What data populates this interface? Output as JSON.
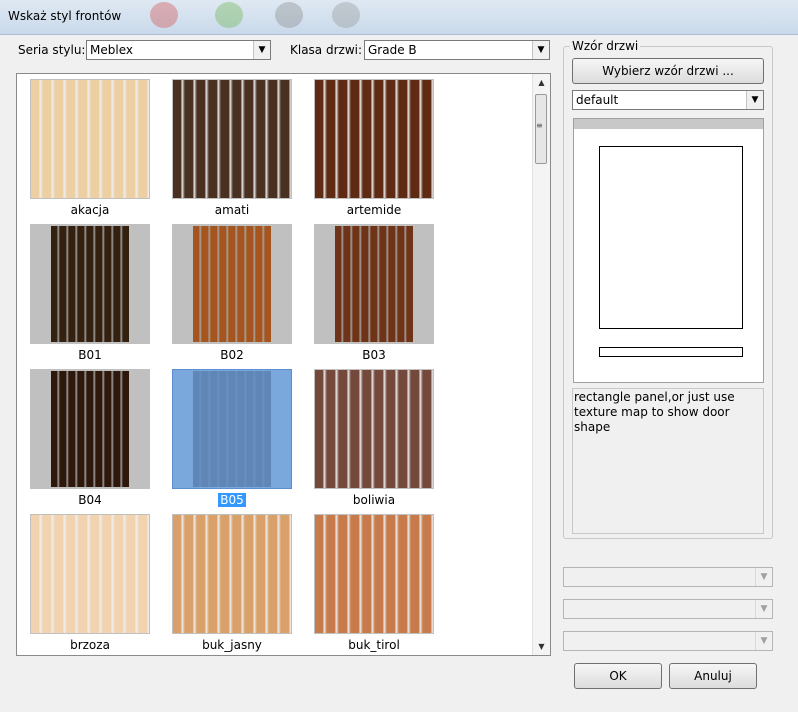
{
  "window": {
    "title": "Wskaż styl frontów"
  },
  "filters": {
    "series_label": "Seria stylu:",
    "series_value": "Meblex",
    "class_label": "Klasa drzwi:",
    "class_value": "Grade B"
  },
  "swatches": [
    {
      "label": "akacja",
      "color": "#ecd0a4",
      "framed": false
    },
    {
      "label": "amati",
      "color": "#4a3020",
      "framed": false
    },
    {
      "label": "artemide",
      "color": "#5e2a14",
      "framed": false
    },
    {
      "label": "B01",
      "color": "#34200f",
      "framed": true
    },
    {
      "label": "B02",
      "color": "#a5551d",
      "framed": true
    },
    {
      "label": "B03",
      "color": "#6f3418",
      "framed": true
    },
    {
      "label": "B04",
      "color": "#2e170b",
      "framed": true
    },
    {
      "label": "B05",
      "color": "#5f86b6",
      "framed": true,
      "selected": true
    },
    {
      "label": "boliwia",
      "color": "#74483a",
      "framed": false
    },
    {
      "label": "brzoza",
      "color": "#f2d3b0",
      "framed": false
    },
    {
      "label": "buk_jasny",
      "color": "#d9a06a",
      "framed": false
    },
    {
      "label": "buk_tirol",
      "color": "#c77a4a",
      "framed": false
    }
  ],
  "door_pattern": {
    "group_title": "Wzór drzwi",
    "choose_button": "Wybierz wzór drzwi ...",
    "style_value": "default",
    "description": "rectangle panel,or just use texture map to show door shape"
  },
  "buttons": {
    "ok": "OK",
    "cancel": "Anuluj"
  },
  "icons": {
    "dropdown": "chevron-down-icon",
    "scroll_up": "arrow-up-icon",
    "scroll_down": "arrow-down-icon"
  }
}
